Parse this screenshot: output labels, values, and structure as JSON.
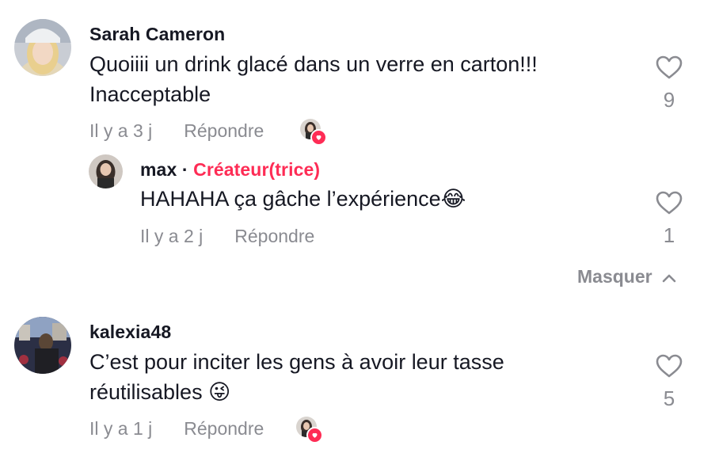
{
  "comments": [
    {
      "username": "Sarah Cameron",
      "text_line1": "Quoiiii un drink glacé dans un verre en carton!!!",
      "text_line2": "Inacceptable",
      "time": "Il y a 3 j",
      "reply_label": "Répondre",
      "likes": "9"
    },
    {
      "username": "kalexia48",
      "text_line1": "C’est pour inciter les gens à avoir leur tasse",
      "text_line2": "réutilisables 😜",
      "time": "Il y a 1 j",
      "reply_label": "Répondre",
      "likes": "5"
    }
  ],
  "reply": {
    "username": "max",
    "separator": "·",
    "creator_badge": "Créateur(trice)",
    "text": "HAHAHA ça gâche l’expérience😂",
    "time": "Il y a 2 j",
    "reply_label": "Répondre",
    "likes": "1"
  },
  "collapse_label": "Masquer",
  "colors": {
    "accent": "#fe2c55",
    "muted": "#8a8b91",
    "text": "#161823"
  }
}
